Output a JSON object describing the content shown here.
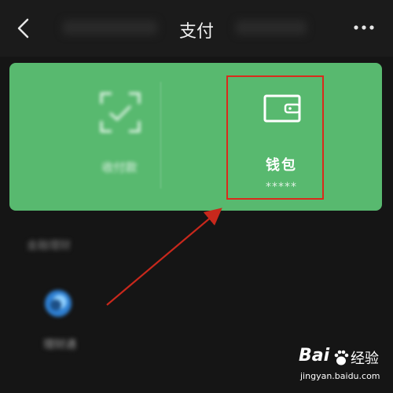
{
  "header": {
    "title": "支付",
    "back_icon": "back-chevron-icon",
    "more_icon": "more-dots-icon"
  },
  "pay_card": {
    "background_color": "#58b96f",
    "scan": {
      "label": "收付款",
      "icon": "scan-frame-icon"
    },
    "wallet": {
      "label": "钱包",
      "balance": "*****",
      "icon": "wallet-icon"
    }
  },
  "section": {
    "label": "金融理财",
    "items": [
      {
        "label": "理财通",
        "icon": "licaitong-icon"
      }
    ]
  },
  "annotation": {
    "highlight_color": "#d92b1c"
  },
  "watermark": {
    "logo": "Bai",
    "cn": "经验",
    "url": "jingyan.baidu.com"
  }
}
